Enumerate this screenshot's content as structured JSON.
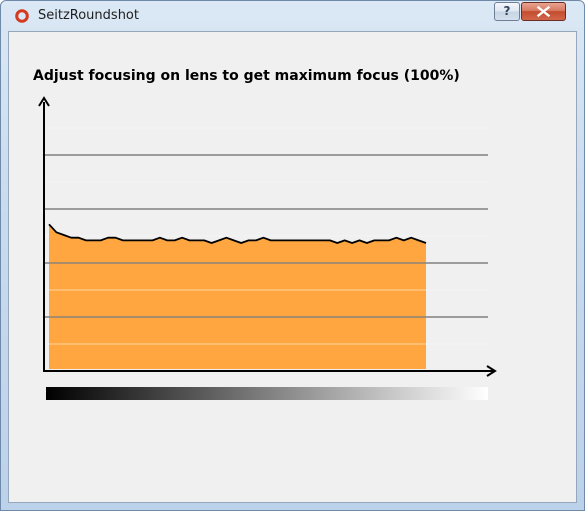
{
  "window": {
    "title": "SeitzRoundshot",
    "help_label": "?",
    "colors": {
      "client_bg": "#f0f0f0",
      "app_icon": "#d63a1e",
      "close_red": "#c24d2f"
    }
  },
  "main": {
    "instruction": "Adjust focusing on lens to get maximum focus (100%)"
  },
  "focus_graph": {
    "fill_color": "#ffa640",
    "line_color": "#000000",
    "grid_color": "#808080",
    "max_level": 1.0,
    "values": [
      0.54,
      0.51,
      0.5,
      0.49,
      0.49,
      0.48,
      0.48,
      0.48,
      0.49,
      0.49,
      0.48,
      0.48,
      0.48,
      0.48,
      0.48,
      0.49,
      0.48,
      0.48,
      0.49,
      0.48,
      0.48,
      0.48,
      0.47,
      0.48,
      0.49,
      0.48,
      0.47,
      0.48,
      0.48,
      0.49,
      0.48,
      0.48,
      0.48,
      0.48,
      0.48,
      0.48,
      0.48,
      0.48,
      0.48,
      0.47,
      0.48,
      0.47,
      0.48,
      0.47,
      0.48,
      0.48,
      0.48,
      0.49,
      0.48,
      0.49,
      0.48,
      0.47
    ]
  }
}
